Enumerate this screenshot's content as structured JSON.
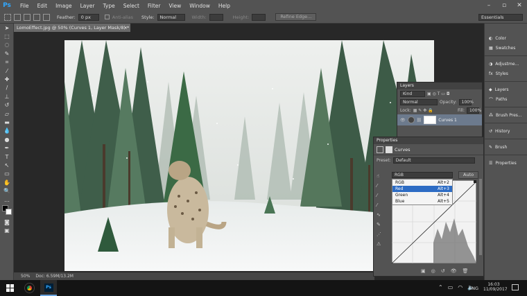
{
  "app": {
    "logo": "Ps",
    "menu": [
      "File",
      "Edit",
      "Image",
      "Layer",
      "Type",
      "Select",
      "Filter",
      "View",
      "Window",
      "Help"
    ]
  },
  "options": {
    "feather_label": "Feather:",
    "feather_value": "0 px",
    "antialias_label": "Anti-alias",
    "style_label": "Style:",
    "style_value": "Normal",
    "width_label": "Width:",
    "height_label": "Height:",
    "refine_edge": "Refine Edge...",
    "workspace": "Essentials"
  },
  "document": {
    "tab_title": "LomoEffect.jpg @ 50% (Curves 1, Layer Mask/8) *"
  },
  "status": {
    "zoom": "50%",
    "doc": "Doc: 6.59M/13.2M"
  },
  "dock": {
    "items": [
      "Color",
      "Swatches",
      "Adjustme...",
      "Styles",
      "Layers",
      "Paths",
      "Brush Pres...",
      "History",
      "Brush",
      "Properties"
    ]
  },
  "layers_panel": {
    "tab": "Layers",
    "kind": "Kind",
    "blend": "Normal",
    "opacity_label": "Opacity:",
    "opacity_value": "100%",
    "lock_label": "Lock:",
    "fill_label": "Fill:",
    "fill_value": "100%",
    "layer_name": "Curves 1"
  },
  "properties_panel": {
    "tab": "Properties",
    "title": "Curves",
    "preset_label": "Preset:",
    "preset_value": "Default",
    "channel": "RGB",
    "auto_label": "Auto",
    "channels": [
      {
        "name": "RGB",
        "shortcut": "Alt+2"
      },
      {
        "name": "Red",
        "shortcut": "Alt+3"
      },
      {
        "name": "Green",
        "shortcut": "Alt+4"
      },
      {
        "name": "Blue",
        "shortcut": "Alt+5"
      }
    ]
  },
  "taskbar": {
    "lang": "ENG",
    "time": "16:03",
    "date": "11/09/2017"
  },
  "colors": {
    "accent": "#31a8ff",
    "panel": "#535353",
    "highlight": "#2d6cc4"
  }
}
